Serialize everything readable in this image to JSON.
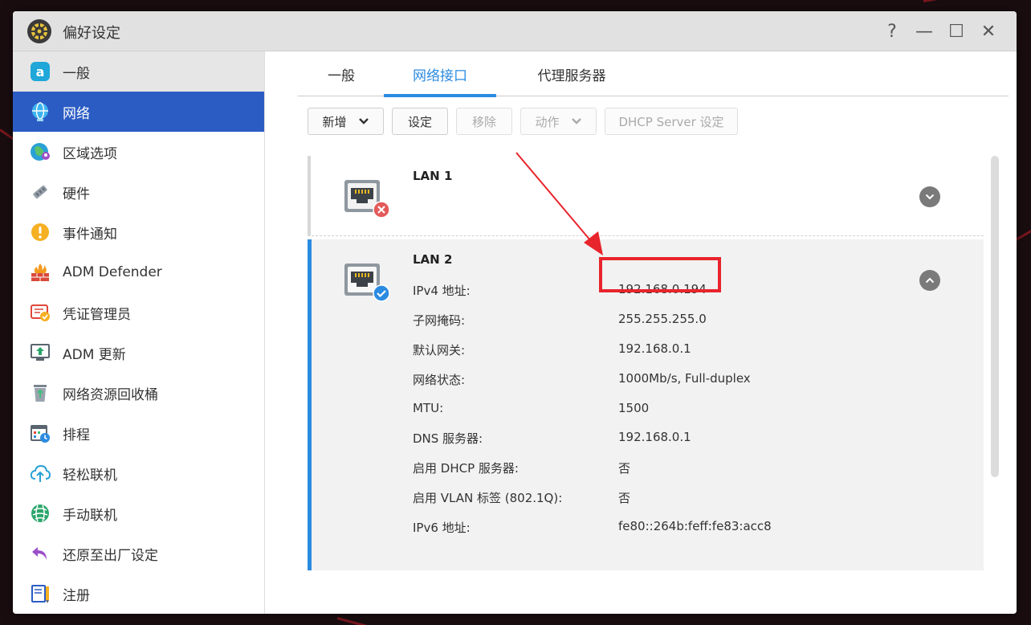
{
  "window": {
    "title": "偏好设定"
  },
  "controls": {
    "help": "?",
    "minimize": "—",
    "maximize": "☐",
    "close": "✕"
  },
  "sidebar": {
    "items": [
      {
        "label": "一般",
        "icon": "general-icon"
      },
      {
        "label": "网络",
        "icon": "globe-icon"
      },
      {
        "label": "区域选项",
        "icon": "region-globe-icon"
      },
      {
        "label": "硬件",
        "icon": "hardware-icon"
      },
      {
        "label": "事件通知",
        "icon": "alert-icon"
      },
      {
        "label": "ADM Defender",
        "icon": "firewall-icon"
      },
      {
        "label": "凭证管理员",
        "icon": "certificate-icon"
      },
      {
        "label": "ADM 更新",
        "icon": "update-icon"
      },
      {
        "label": "网络资源回收桶",
        "icon": "recycle-bin-icon"
      },
      {
        "label": "排程",
        "icon": "schedule-icon"
      },
      {
        "label": "轻松联机",
        "icon": "cloud-connect-icon"
      },
      {
        "label": "手动联机",
        "icon": "manual-connect-icon"
      },
      {
        "label": "还原至出厂设定",
        "icon": "restore-icon"
      },
      {
        "label": "注册",
        "icon": "register-icon"
      }
    ]
  },
  "tabs": [
    {
      "label": "一般"
    },
    {
      "label": "网络接口"
    },
    {
      "label": "代理服务器"
    }
  ],
  "toolbar": {
    "add": "新增",
    "settings": "设定",
    "remove": "移除",
    "action": "动作",
    "dhcp": "DHCP Server 设定"
  },
  "lan1": {
    "title": "LAN 1",
    "status": "disconnected"
  },
  "lan2": {
    "title": "LAN 2",
    "status": "connected",
    "rows": [
      {
        "label": "IPv4 地址:",
        "value": "192.168.0.194"
      },
      {
        "label": "子网掩码:",
        "value": "255.255.255.0"
      },
      {
        "label": "默认网关:",
        "value": "192.168.0.1"
      },
      {
        "label": "网络状态:",
        "value": "1000Mb/s, Full-duplex"
      },
      {
        "label": "MTU:",
        "value": "1500"
      },
      {
        "label": "DNS 服务器:",
        "value": "192.168.0.1"
      },
      {
        "label": "启用 DHCP 服务器:",
        "value": "否"
      },
      {
        "label": "启用 VLAN 标签 (802.1Q):",
        "value": "否"
      },
      {
        "label": "IPv6 地址:",
        "value": "fe80::264b:feff:fe83:acc8"
      }
    ]
  },
  "colors": {
    "accent": "#2b8be0",
    "active_sidebar": "#2b5cc4",
    "annotation": "#e8242c",
    "error_badge": "#e45a5a",
    "ok_badge": "#2b8be0"
  }
}
